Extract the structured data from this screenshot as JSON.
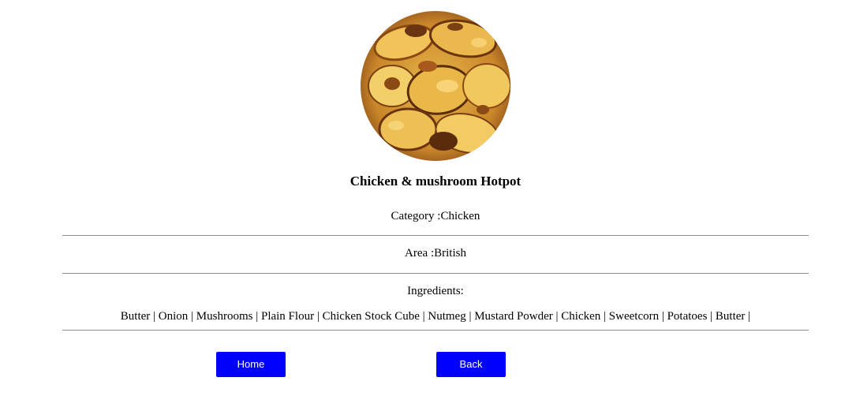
{
  "recipe": {
    "image_alt": "Chicken & mushroom Hotpot photo",
    "title": "Chicken & mushroom Hotpot",
    "category_text": "Category :Chicken",
    "area_text": "Area :British",
    "ingredients_label": "Ingredients:",
    "ingredients_text": "Butter | Onion | Mushrooms | Plain Flour | Chicken Stock Cube | Nutmeg | Mustard Powder | Chicken | Sweetcorn | Potatoes | Butter |"
  },
  "buttons": {
    "home_label": "Home",
    "back_label": "Back"
  },
  "colors": {
    "button_bg": "#0000ff",
    "button_text": "#ffffff",
    "divider": "#8a8a8a"
  }
}
